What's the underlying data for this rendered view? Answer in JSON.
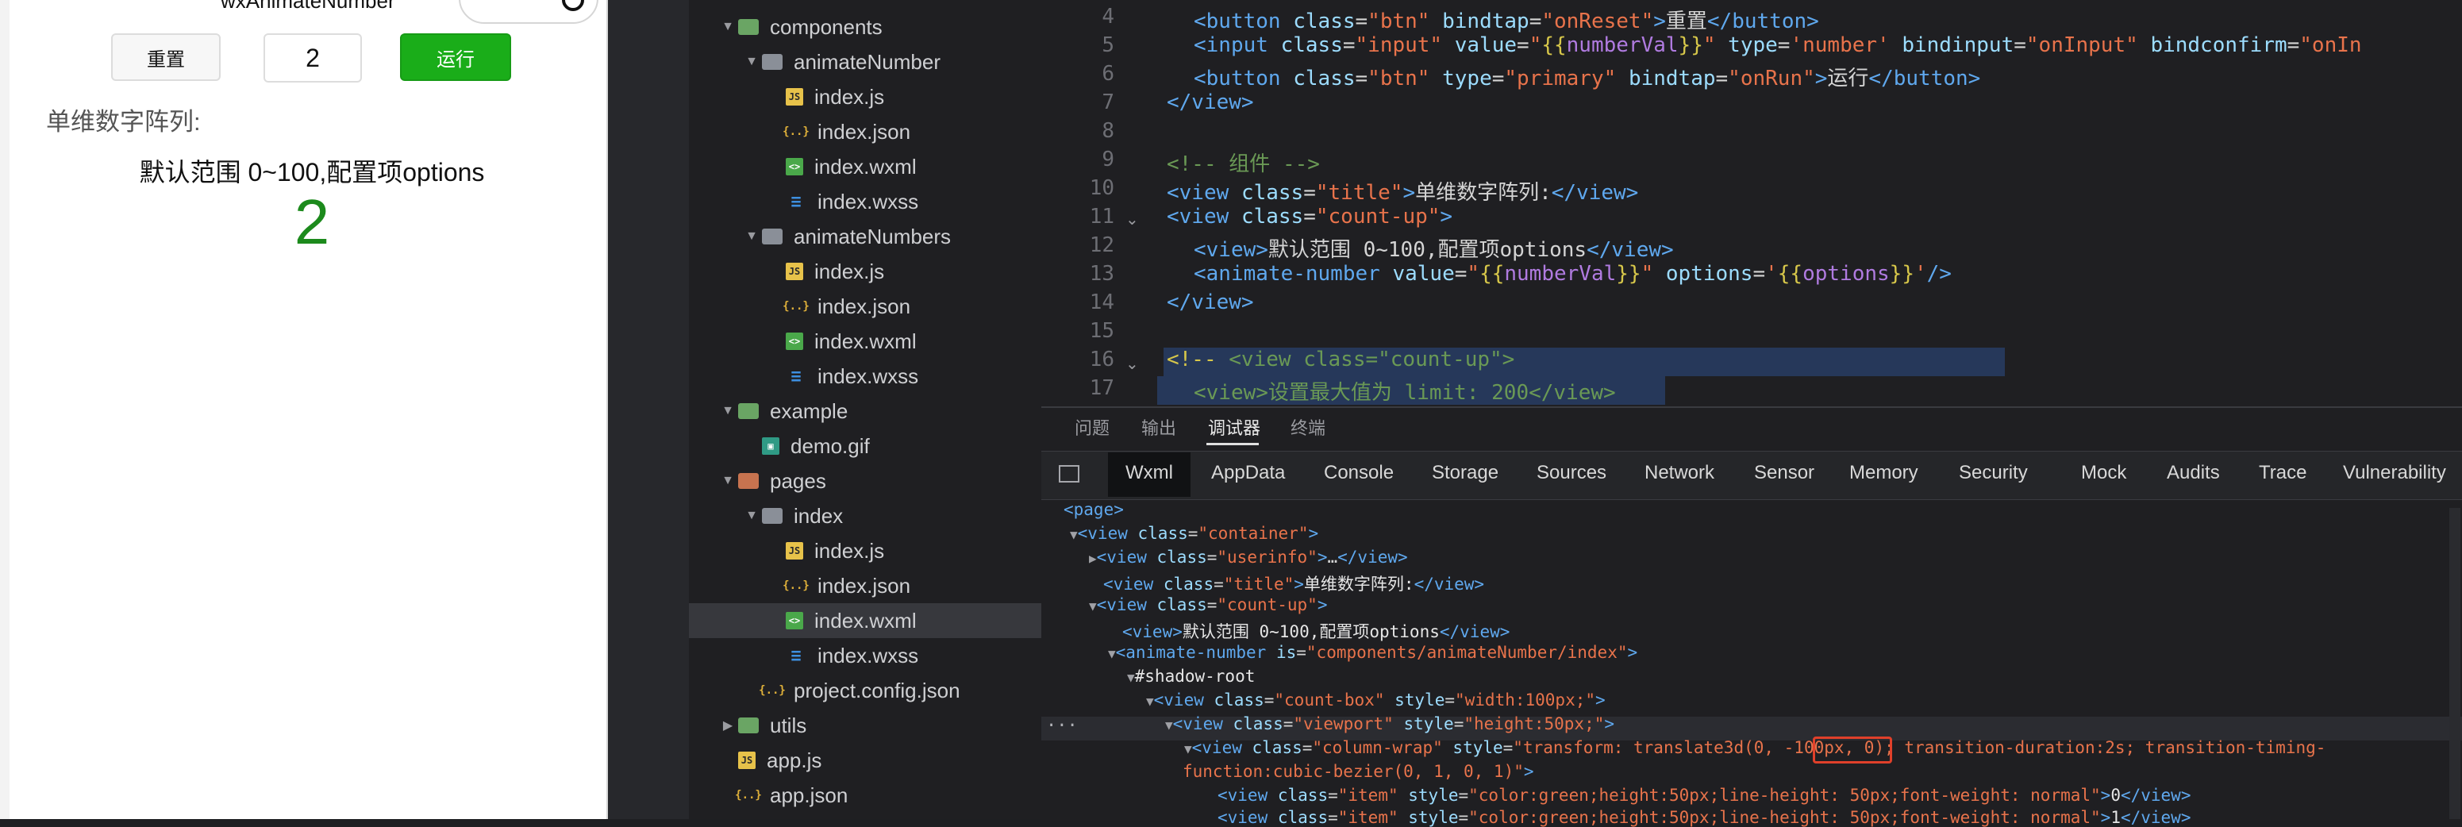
{
  "simulator": {
    "title": "wxAnimateNumber",
    "reset_label": "重置",
    "input_value": "2",
    "run_label": "运行",
    "section_title": "单维数字阵列:",
    "default_range_text": "默认范围 0~100,配置项options",
    "animated_number": "2",
    "accent_color": "#1aad19"
  },
  "file_tree": [
    {
      "label": "components",
      "type": "folder",
      "depth": 0,
      "open": true
    },
    {
      "label": "animateNumber",
      "type": "folder",
      "depth": 1,
      "open": true
    },
    {
      "label": "index.js",
      "type": "js",
      "depth": 2
    },
    {
      "label": "index.json",
      "type": "json",
      "depth": 2
    },
    {
      "label": "index.wxml",
      "type": "wxml",
      "depth": 2
    },
    {
      "label": "index.wxss",
      "type": "wxss",
      "depth": 2
    },
    {
      "label": "animateNumbers",
      "type": "folder",
      "depth": 1,
      "open": true
    },
    {
      "label": "index.js",
      "type": "js",
      "depth": 2
    },
    {
      "label": "index.json",
      "type": "json",
      "depth": 2
    },
    {
      "label": "index.wxml",
      "type": "wxml",
      "depth": 2
    },
    {
      "label": "index.wxss",
      "type": "wxss",
      "depth": 2
    },
    {
      "label": "example",
      "type": "folder",
      "depth": 0,
      "open": true
    },
    {
      "label": "demo.gif",
      "type": "gif",
      "depth": 1
    },
    {
      "label": "pages",
      "type": "folder",
      "depth": 0,
      "open": true
    },
    {
      "label": "index",
      "type": "folder",
      "depth": 1,
      "open": true
    },
    {
      "label": "index.js",
      "type": "js",
      "depth": 2
    },
    {
      "label": "index.json",
      "type": "json",
      "depth": 2
    },
    {
      "label": "index.wxml",
      "type": "wxml",
      "depth": 2,
      "selected": true
    },
    {
      "label": "index.wxss",
      "type": "wxss",
      "depth": 2
    },
    {
      "label": "project.config.json",
      "type": "json",
      "depth": 1
    },
    {
      "label": "utils",
      "type": "folder",
      "depth": 0,
      "open": false
    },
    {
      "label": "app.js",
      "type": "js",
      "depth": 0
    },
    {
      "label": "app.json",
      "type": "json",
      "depth": 0
    }
  ],
  "editor": {
    "line_numbers": [
      "4",
      "5",
      "6",
      "7",
      "8",
      "9",
      "10",
      "11",
      "12",
      "13",
      "14",
      "15",
      "16",
      "17"
    ],
    "lines": [
      "<button class=\"btn\" bindtap=\"onReset\">重置</button>",
      "<input class=\"input\" value=\"{{numberVal}}\" type='number' bindinput=\"onInput\" bindconfirm=\"onIn",
      "<button class=\"btn\" type=\"primary\" bindtap=\"onRun\">运行</button>",
      "</view>",
      "",
      "<!-- 组件 -->",
      "<view class=\"title\">单维数字阵列:</view>",
      "<view class=\"count-up\">",
      "<view>默认范围 0~100,配置项options</view>",
      "<animate-number value=\"{{numberVal}}\" options='{{options}}'/>",
      "</view>",
      "",
      "<!-- <view class=\"count-up\">",
      "<view>设置最大值为 limit: 200</view>"
    ]
  },
  "panel_tabs": [
    "问题",
    "输出",
    "调试器",
    "终端"
  ],
  "devtools_tabs": [
    "Wxml",
    "AppData",
    "Console",
    "Storage",
    "Sources",
    "Network",
    "Sensor",
    "Memory",
    "Security",
    "Mock",
    "Audits",
    "Trace",
    "Vulnerability"
  ],
  "dom_tree": [
    "<page>",
    "<view class=\"container\">",
    "<view class=\"userinfo\">…</view>",
    "<view class=\"title\">单维数字阵列:</view>",
    "<view class=\"count-up\">",
    "<view>默认范围 0~100,配置项options</view>",
    "<animate-number is=\"components/animateNumber/index\">",
    "#shadow-root",
    "<view class=\"count-box\" style=\"width:100px;\">",
    "<view class=\"viewport\" style=\"height:50px;\">",
    "<view class=\"column-wrap\" style=\"transform: translate3d(0, -100px, 0); transition-duration:2s; transition-timing-",
    "function:cubic-bezier(0, 1, 0, 1)\">",
    "<view class=\"item\" style=\"color:green;height:50px;line-height: 50px;font-weight: normal\">0</view>",
    "<view class=\"item\" style=\"color:green;height:50px;line-height: 50px;font-weight: normal\">1</view>"
  ],
  "highlighted_value": "-100px"
}
